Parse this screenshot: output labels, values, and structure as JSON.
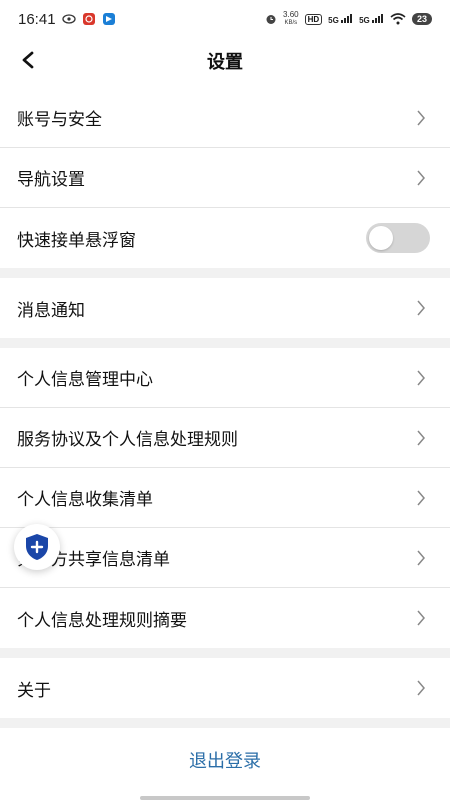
{
  "status_bar": {
    "time": "16:41",
    "net_speed_value": "3.60",
    "net_speed_unit": "KB/s",
    "hd_badge": "HD",
    "sig1": "5G",
    "sig2": "5G",
    "battery": "23"
  },
  "header": {
    "title": "设置"
  },
  "settings": {
    "account_security": "账号与安全",
    "navigation": "导航设置",
    "quick_order_float": "快速接单悬浮窗",
    "quick_order_float_enabled": false,
    "notifications": "消息通知",
    "privacy_center": "个人信息管理中心",
    "service_agreement": "服务协议及个人信息处理规则",
    "info_collection_list": "个人信息收集清单",
    "third_party_sharing_list": "第三方共享信息清单",
    "privacy_rules_summary": "个人信息处理规则摘要",
    "about": "关于"
  },
  "footer": {
    "logout": "退出登录"
  },
  "colors": {
    "accent": "#2b6ea8",
    "shield": "#1a46a8",
    "toggle_off": "#d6d6d6",
    "separator": "#f1f1f1"
  }
}
